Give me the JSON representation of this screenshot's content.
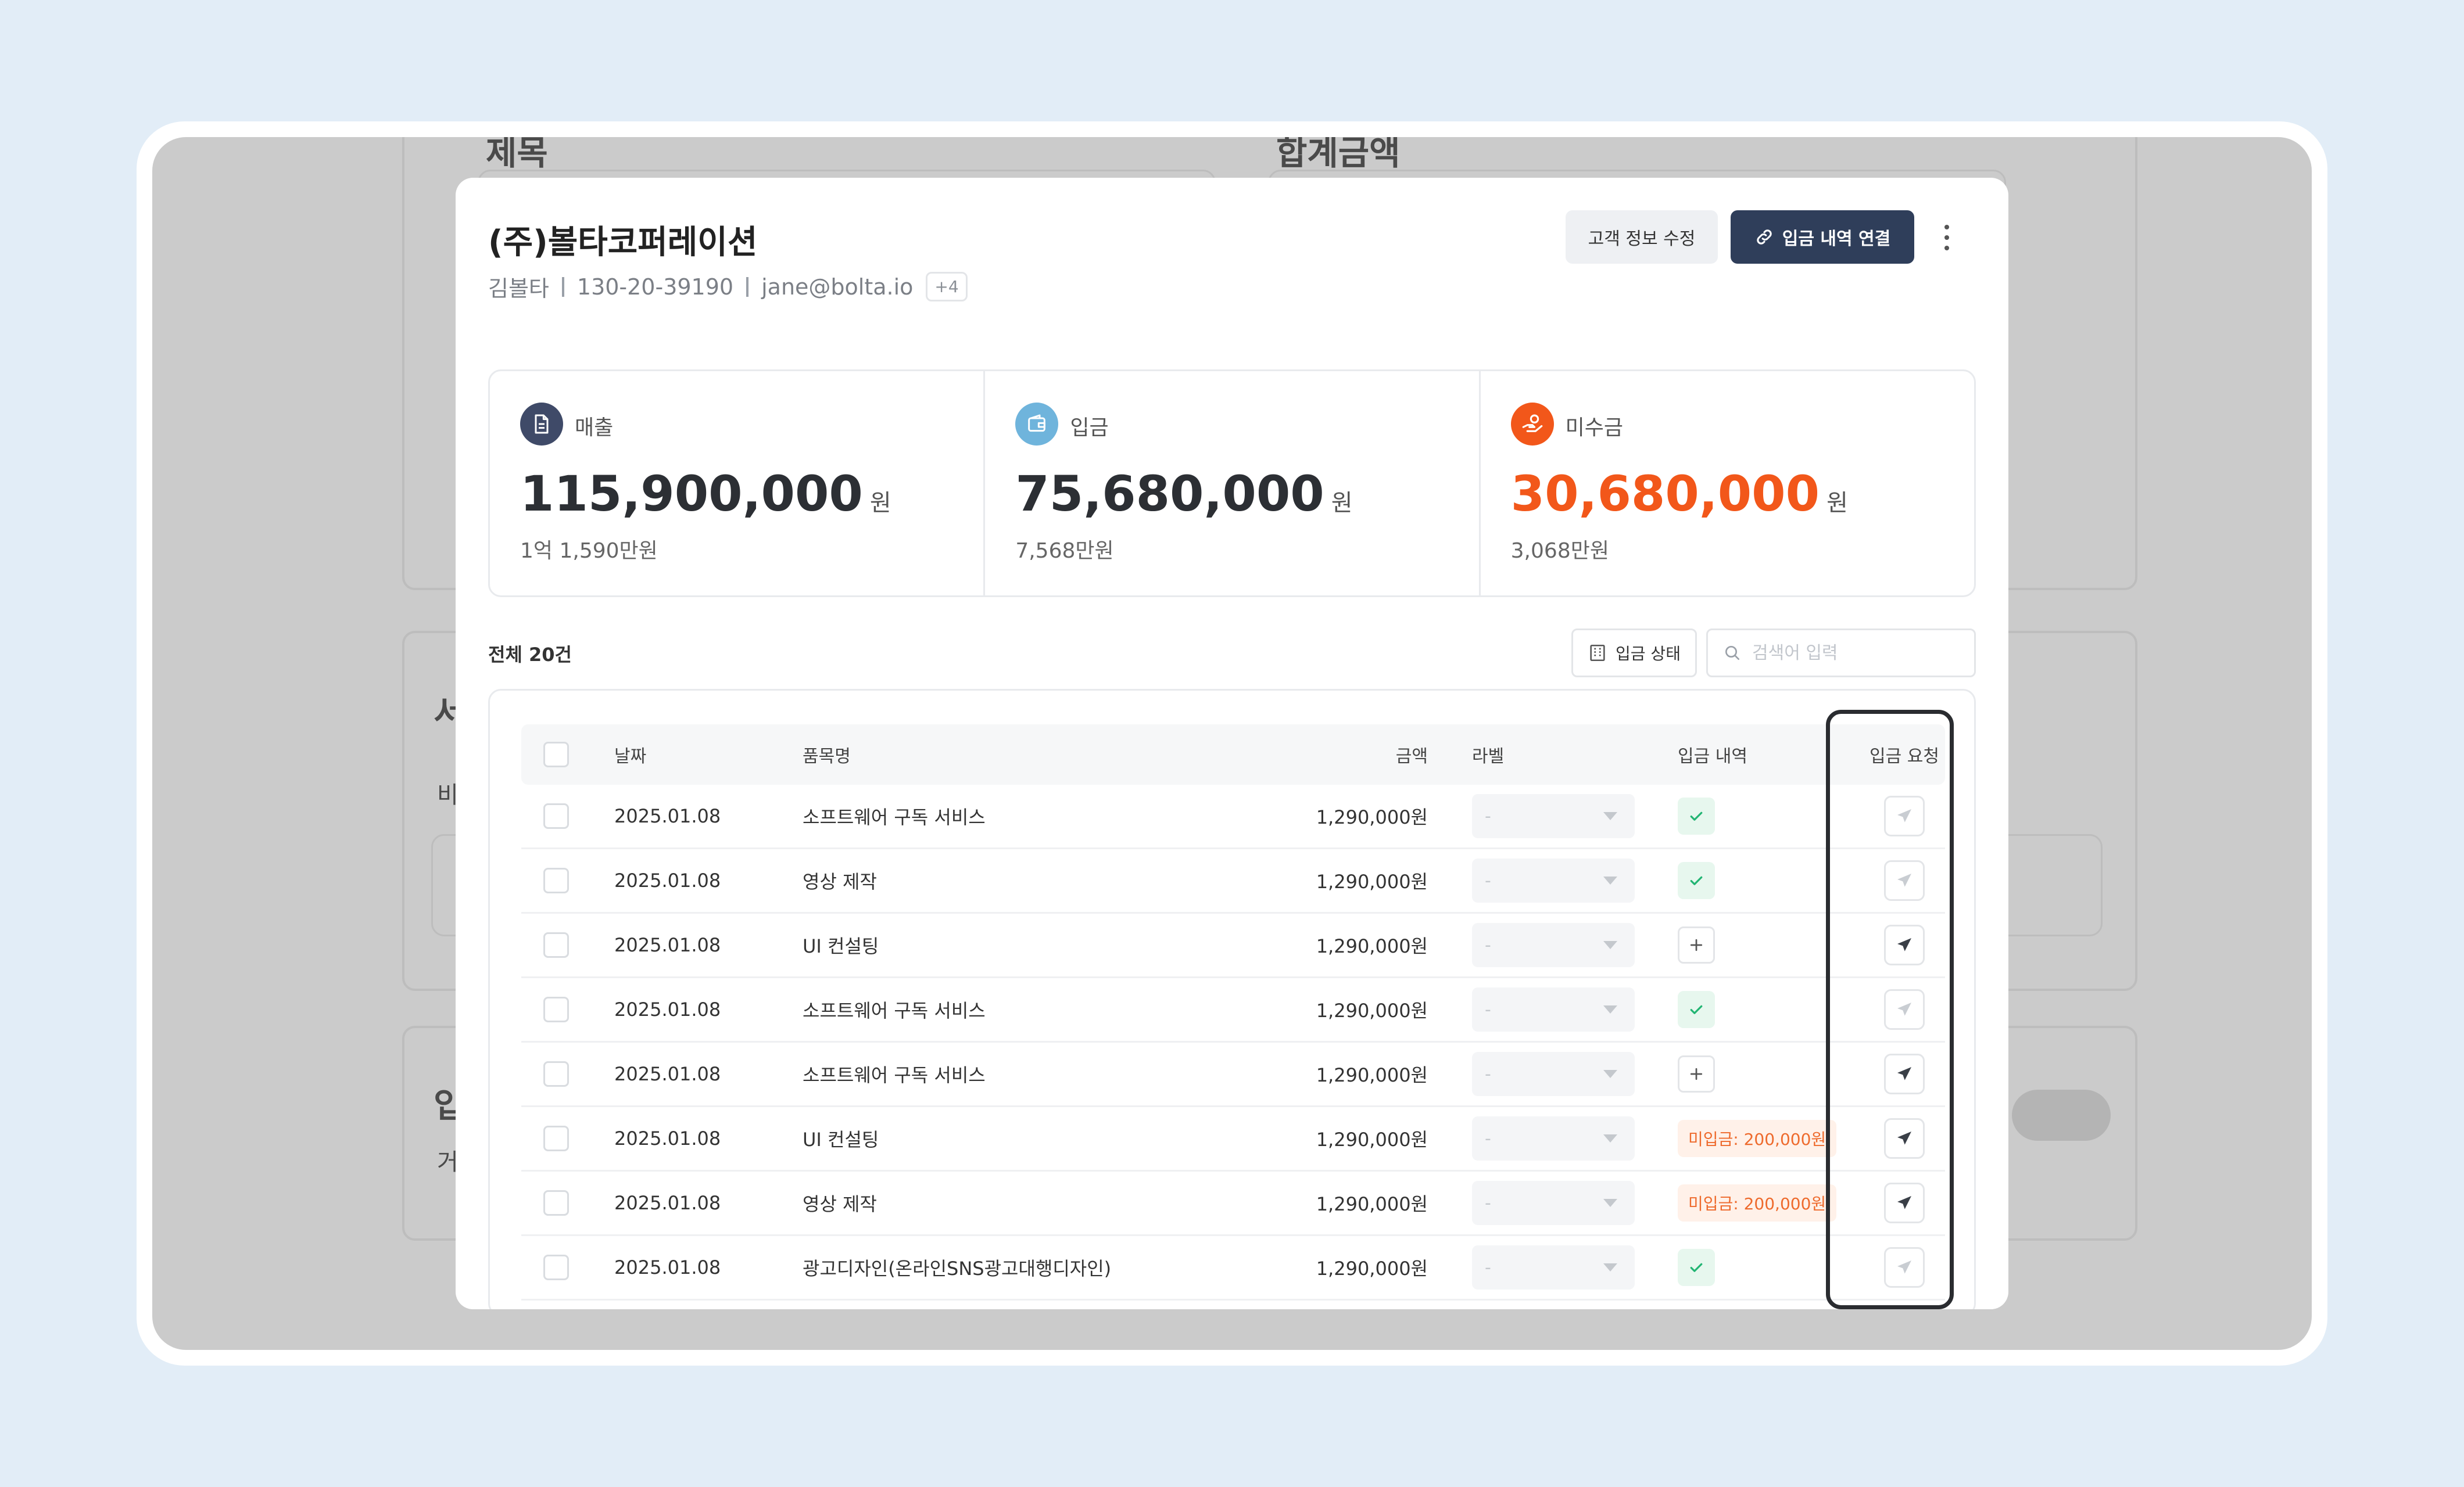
{
  "background_page": {
    "label_1": "제목",
    "label_2": "합계금액",
    "heading_2": "서",
    "text_2": "비",
    "heading_3": "입",
    "text_3": "거"
  },
  "customer": {
    "name": "(주)볼타코퍼레이션",
    "contact_name": "김볼타",
    "business_number": "130-20-39190",
    "email": "jane@bolta.io",
    "more_count": "+4"
  },
  "actions": {
    "edit_label": "고객 정보 수정",
    "link_label": "입금 내역 연결"
  },
  "summary": [
    {
      "label": "매출",
      "value": "115,900,000",
      "unit": "원",
      "sub": "1억 1,590만원",
      "icon": "document-icon",
      "color": "#3f4a68"
    },
    {
      "label": "입금",
      "value": "75,680,000",
      "unit": "원",
      "sub": "7,568만원",
      "icon": "wallet-icon",
      "color": "#6fb4dc"
    },
    {
      "label": "미수금",
      "value": "30,680,000",
      "unit": "원",
      "sub": "3,068만원",
      "icon": "hand-coin-icon",
      "color": "#f2571a"
    }
  ],
  "list": {
    "total_label": "전체 20건",
    "filter_label": "입금 상태",
    "search_placeholder": "검색어 입력"
  },
  "table": {
    "headers": {
      "date": "날짜",
      "item": "품목명",
      "amount": "금액",
      "label": "라벨",
      "deposit": "입금 내역",
      "request": "입금 요청"
    },
    "rows": [
      {
        "date": "2025.01.08",
        "item": "소프트웨어 구독 서비스",
        "amount": "1,290,000원",
        "label": "-",
        "deposit_status": "matched",
        "request_enabled": false
      },
      {
        "date": "2025.01.08",
        "item": "영상 제작",
        "amount": "1,290,000원",
        "label": "-",
        "deposit_status": "matched",
        "request_enabled": false
      },
      {
        "date": "2025.01.08",
        "item": "UI 컨설팅",
        "amount": "1,290,000원",
        "label": "-",
        "deposit_status": "add",
        "request_enabled": true
      },
      {
        "date": "2025.01.08",
        "item": "소프트웨어 구독 서비스",
        "amount": "1,290,000원",
        "label": "-",
        "deposit_status": "matched",
        "request_enabled": false
      },
      {
        "date": "2025.01.08",
        "item": "소프트웨어 구독 서비스",
        "amount": "1,290,000원",
        "label": "-",
        "deposit_status": "add",
        "request_enabled": true
      },
      {
        "date": "2025.01.08",
        "item": "UI 컨설팅",
        "amount": "1,290,000원",
        "label": "-",
        "deposit_status": "unpaid",
        "unpaid_text": "미입금: 200,000원",
        "request_enabled": true
      },
      {
        "date": "2025.01.08",
        "item": "영상 제작",
        "amount": "1,290,000원",
        "label": "-",
        "deposit_status": "unpaid",
        "unpaid_text": "미입금: 200,000원",
        "request_enabled": true
      },
      {
        "date": "2025.01.08",
        "item": "광고디자인(온라인SNS광고대행디자인)",
        "amount": "1,290,000원",
        "label": "-",
        "deposit_status": "matched",
        "request_enabled": false
      }
    ]
  },
  "colors": {
    "primary_button": "#2f3e5a",
    "overdue_accent": "#f2571a",
    "matched_check": "#22b573",
    "unpaid_text": "#ee6a2c",
    "highlight_border": "#2a2c30"
  }
}
